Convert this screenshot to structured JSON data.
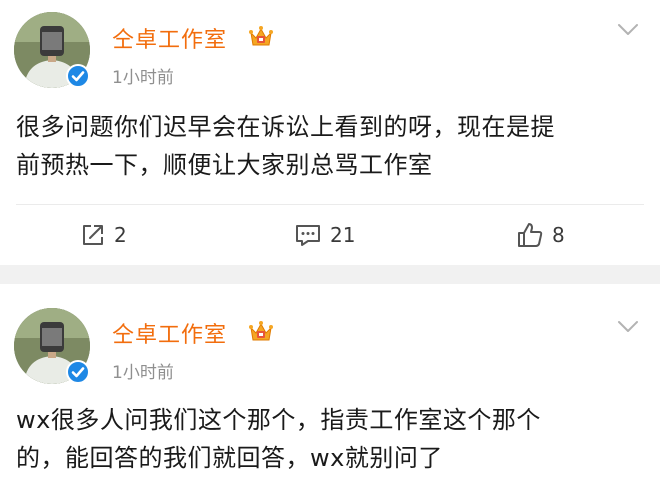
{
  "posts": [
    {
      "username": "仝卓工作室",
      "timestamp": "1小时前",
      "text_lines": [
        "很多问题你们迟早会在诉讼上看到的呀，现在是提",
        "前预热一下，顺便让大家别总骂工作室"
      ],
      "actions": {
        "repost_count": "2",
        "comment_count": "21",
        "like_count": "8"
      }
    },
    {
      "username": "仝卓工作室",
      "timestamp": "1小时前",
      "text_lines": [
        "wx很多人问我们这个那个，指责工作室这个那个",
        "的，能回答的我们就回答，wx就别问了"
      ]
    }
  ],
  "icons": {
    "verified": "verified-badge-icon",
    "membership": "crown-membership-icon",
    "menu": "chevron-down-icon",
    "repost": "repost-icon",
    "comment": "comment-icon",
    "like": "thumbs-up-icon"
  },
  "colors": {
    "username": "#f26d0d",
    "verified": "#1e88e5",
    "timestamp": "#8f8f8f",
    "text": "#1a1a1a",
    "divider": "#f1f1f1"
  }
}
